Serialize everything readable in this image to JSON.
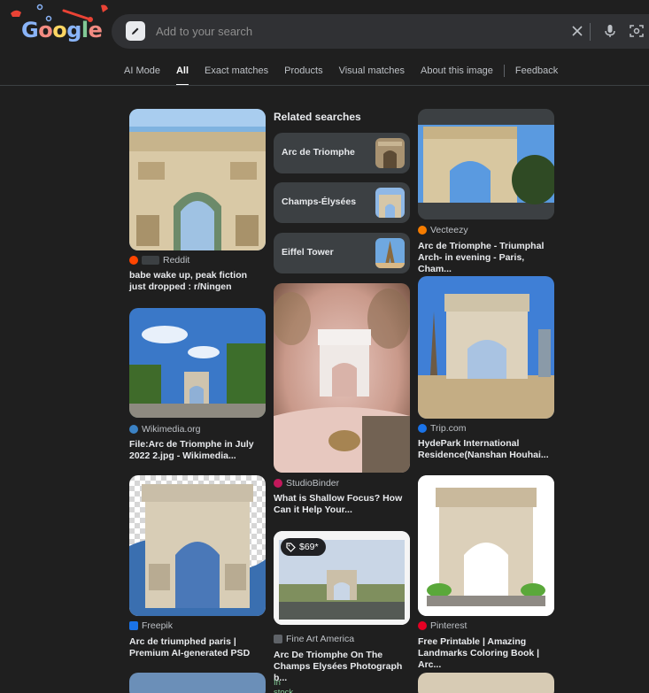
{
  "header": {
    "logo_text": "Google",
    "search_placeholder": "Add to your search"
  },
  "tabs": [
    {
      "label": "AI Mode",
      "active": false
    },
    {
      "label": "All",
      "active": true
    },
    {
      "label": "Exact matches",
      "active": false
    },
    {
      "label": "Products",
      "active": false
    },
    {
      "label": "Visual matches",
      "active": false
    },
    {
      "label": "About this image",
      "active": false
    },
    {
      "label": "Feedback",
      "active": false
    }
  ],
  "related": {
    "heading": "Related searches",
    "items": [
      {
        "label": "Arc de Triomphe"
      },
      {
        "label": "Champs-Élysées"
      },
      {
        "label": "Eiffel Tower"
      }
    ]
  },
  "results": {
    "reddit": {
      "source": "Reddit",
      "title": "babe wake up, peak fiction just dropped : r/Ningen"
    },
    "wikimedia": {
      "source": "Wikimedia.org",
      "title": "File:Arc de Triomphe in July 2022 2.jpg - Wikimedia..."
    },
    "freepik": {
      "source": "Freepik",
      "title": "Arc de triumphed paris | Premium AI-generated PSD"
    },
    "studiobinder": {
      "source": "StudioBinder",
      "title": "What is Shallow Focus? How Can it Help Your..."
    },
    "fineart": {
      "source": "Fine Art America",
      "title": "Arc De Triomphe On The Champs Elysées Photograph b...",
      "price": "$69*",
      "stock": "In stock"
    },
    "vecteezy": {
      "source": "Vecteezy",
      "title": "Arc de Triomphe - Triumphal Arch- in evening - Paris, Cham..."
    },
    "trip": {
      "source": "Trip.com",
      "title": "HydePark International Residence(Nanshan Houhai..."
    },
    "pinterest": {
      "source": "Pinterest",
      "title": "Free Printable | Amazing Landmarks Coloring Book | Arc..."
    }
  },
  "colors": {
    "background": "#1f1f1f",
    "search_bar": "#303134",
    "chip": "#3c4043",
    "in_stock": "#81c995"
  },
  "icons": [
    "pencil-icon",
    "clear-icon",
    "mic-icon",
    "camera-lens-icon",
    "tag-icon"
  ]
}
